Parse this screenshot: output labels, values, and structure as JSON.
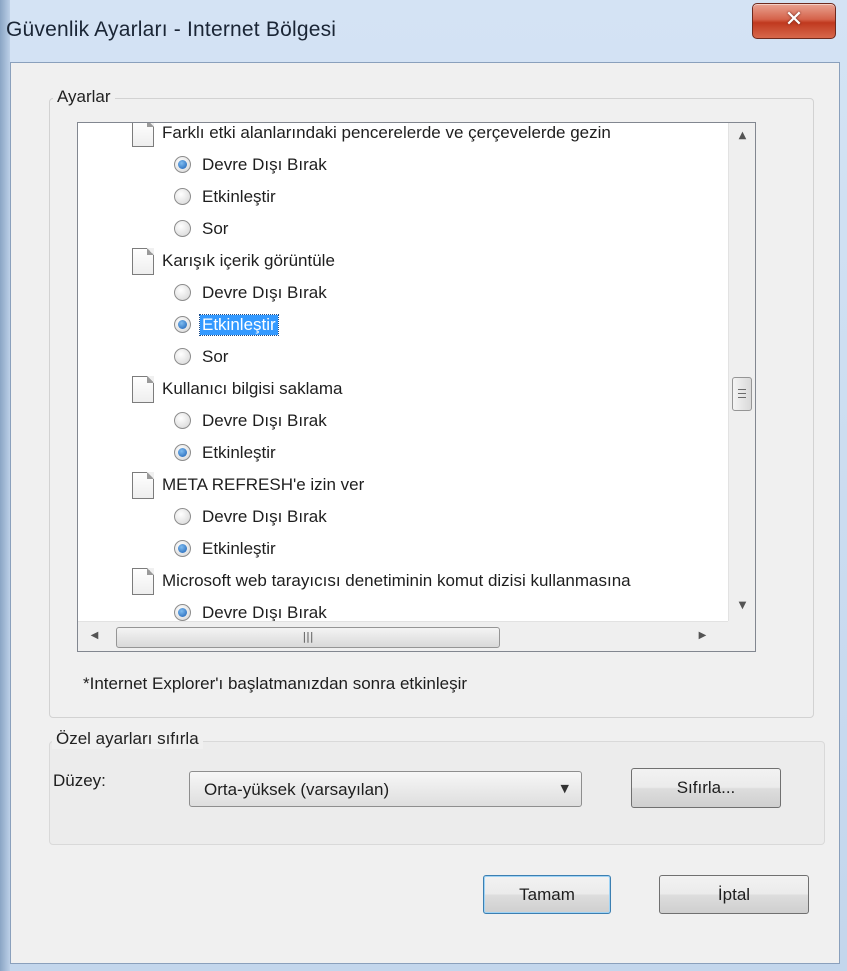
{
  "window": {
    "title": "Güvenlik Ayarları - Internet Bölgesi",
    "close_glyph": "✕"
  },
  "settings_group": {
    "label": "Ayarlar",
    "rows": [
      {
        "type": "setting",
        "label": "Farklı etki alanlarındaki pencerelerde ve çerçevelerde gezin"
      },
      {
        "type": "option",
        "label": "Devre Dışı Bırak",
        "checked": true,
        "highlighted": false
      },
      {
        "type": "option",
        "label": "Etkinleştir",
        "checked": false,
        "highlighted": false
      },
      {
        "type": "option",
        "label": "Sor",
        "checked": false,
        "highlighted": false
      },
      {
        "type": "setting",
        "label": "Karışık içerik görüntüle"
      },
      {
        "type": "option",
        "label": "Devre Dışı Bırak",
        "checked": false,
        "highlighted": false
      },
      {
        "type": "option",
        "label": "Etkinleştir",
        "checked": true,
        "highlighted": true
      },
      {
        "type": "option",
        "label": "Sor",
        "checked": false,
        "highlighted": false
      },
      {
        "type": "setting",
        "label": "Kullanıcı bilgisi saklama"
      },
      {
        "type": "option",
        "label": "Devre Dışı Bırak",
        "checked": false,
        "highlighted": false
      },
      {
        "type": "option",
        "label": "Etkinleştir",
        "checked": true,
        "highlighted": false
      },
      {
        "type": "setting",
        "label": "META REFRESH'e izin ver"
      },
      {
        "type": "option",
        "label": "Devre Dışı Bırak",
        "checked": false,
        "highlighted": false
      },
      {
        "type": "option",
        "label": "Etkinleştir",
        "checked": true,
        "highlighted": false
      },
      {
        "type": "setting",
        "label": "Microsoft web tarayıcısı denetiminin komut dizisi kullanmasına"
      },
      {
        "type": "option",
        "label": "Devre Dışı Bırak",
        "checked": true,
        "highlighted": false
      }
    ],
    "scrollbar": {
      "up_glyph": "▲",
      "down_glyph": "▼",
      "left_glyph": "◀",
      "right_glyph": "▶",
      "grip_glyph": "|||"
    },
    "note": "*Internet Explorer'ı başlatmanızdan sonra etkinleşir"
  },
  "reset_group": {
    "label": "Özel ayarları sıfırla",
    "level_label": "Düzey:",
    "level_value": "Orta-yüksek (varsayılan)",
    "dropdown_glyph": "▼",
    "reset_button": "Sıfırla..."
  },
  "buttons": {
    "ok": "Tamam",
    "cancel": "İptal"
  }
}
